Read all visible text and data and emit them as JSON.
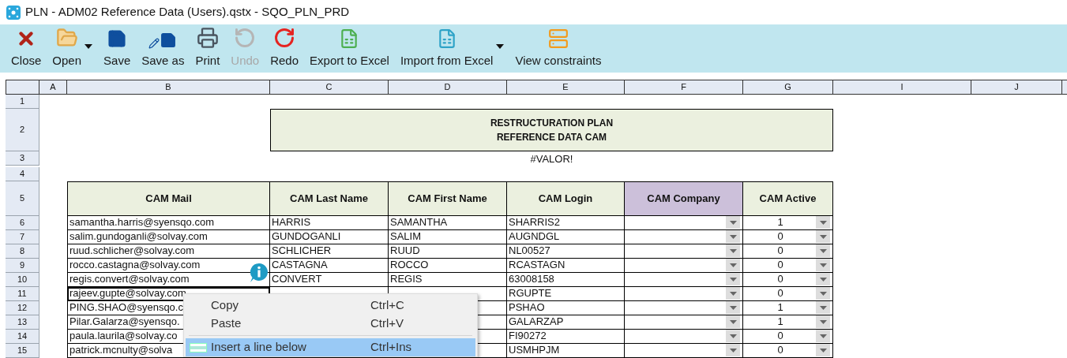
{
  "window": {
    "title": "PLN - ADM02 Reference Data (Users).qstx - SQO_PLN_PRD"
  },
  "toolbar": [
    {
      "kind": "close",
      "label": "Close",
      "disabled": false,
      "has_menu": false
    },
    {
      "kind": "open",
      "label": "Open",
      "disabled": false,
      "has_menu": true
    },
    {
      "kind": "save",
      "label": "Save",
      "disabled": false,
      "has_menu": false
    },
    {
      "kind": "saveas",
      "label": "Save as",
      "disabled": false,
      "has_menu": false
    },
    {
      "kind": "print",
      "label": "Print",
      "disabled": false,
      "has_menu": false
    },
    {
      "kind": "undo",
      "label": "Undo",
      "disabled": true,
      "has_menu": false
    },
    {
      "kind": "redo",
      "label": "Redo",
      "disabled": false,
      "has_menu": false
    },
    {
      "kind": "export",
      "label": "Export to Excel",
      "disabled": false,
      "has_menu": false
    },
    {
      "kind": "import",
      "label": "Import from Excel",
      "disabled": false,
      "has_menu": true
    },
    {
      "kind": "constraints",
      "label": "View constraints",
      "disabled": false,
      "has_menu": false
    }
  ],
  "sheet": {
    "columns": [
      "A",
      "B",
      "C",
      "D",
      "E",
      "F",
      "G",
      "I",
      "J"
    ],
    "top_rows": [
      "1",
      "2",
      "3",
      "4",
      "5"
    ],
    "title_lines": [
      "RESTRUCTURATION PLAN",
      "REFERENCE DATA CAM"
    ],
    "error": "#VALOR!",
    "headers": [
      {
        "label": "CAM Mail",
        "color": "#ebf0df"
      },
      {
        "label": "CAM Last Name",
        "color": "#ebf0df"
      },
      {
        "label": "CAM First Name",
        "color": "#ebf0df"
      },
      {
        "label": "CAM Login",
        "color": "#ebf0df"
      },
      {
        "label": "CAM Company",
        "color": "#ccc0da"
      },
      {
        "label": "CAM Active",
        "color": "#ebf0df"
      }
    ],
    "rows": [
      {
        "number": "6",
        "mail": "samantha.harris@syensqo.com",
        "last_name": "HARRIS",
        "first_name": "SAMANTHA",
        "login": "SHARRIS2",
        "active": "1",
        "selected": false
      },
      {
        "number": "7",
        "mail": "salim.gundoganli@solvay.com",
        "last_name": "GUNDOGANLI",
        "first_name": "SALIM",
        "login": "AUGNDGL",
        "active": "0",
        "selected": false
      },
      {
        "number": "8",
        "mail": "ruud.schlicher@solvay.com",
        "last_name": "SCHLICHER",
        "first_name": "RUUD",
        "login": "NL00527",
        "active": "0",
        "selected": false
      },
      {
        "number": "9",
        "mail": "rocco.castagna@solvay.com",
        "last_name": "CASTAGNA",
        "first_name": "ROCCO",
        "login": "RCASTAGN",
        "active": "0",
        "selected": false
      },
      {
        "number": "10",
        "mail": "regis.convert@solvay.com",
        "last_name": "CONVERT",
        "first_name": "REGIS",
        "login": "63008158",
        "active": "0",
        "selected": false
      },
      {
        "number": "11",
        "mail": "rajeev.gupte@solvay.com",
        "login": "RGUPTE",
        "active": "0",
        "selected": true
      },
      {
        "number": "12",
        "mail": "PING.SHAO@syensqo.c",
        "login": "PSHAO",
        "active": "1",
        "selected": false
      },
      {
        "number": "13",
        "mail": "Pilar.Galarza@syensqo.",
        "login": "GALARZAP",
        "active": "1",
        "selected": false
      },
      {
        "number": "14",
        "mail": "paula.laurila@solvay.co",
        "login": "FI90272",
        "active": "0",
        "selected": false
      },
      {
        "number": "15",
        "mail": "patrick.mcnulty@solva",
        "login": "USMHPJM",
        "active": "0",
        "selected": false
      }
    ]
  },
  "context_menu": [
    {
      "kind": "plain",
      "label": "Copy",
      "shortcut": "Ctrl+C",
      "selected": false
    },
    {
      "kind": "plain",
      "label": "Paste",
      "shortcut": "Ctrl+V",
      "selected": false
    },
    {
      "kind": "insert",
      "label": "Insert a line below",
      "shortcut": "Ctrl+Ins",
      "selected": true
    }
  ]
}
